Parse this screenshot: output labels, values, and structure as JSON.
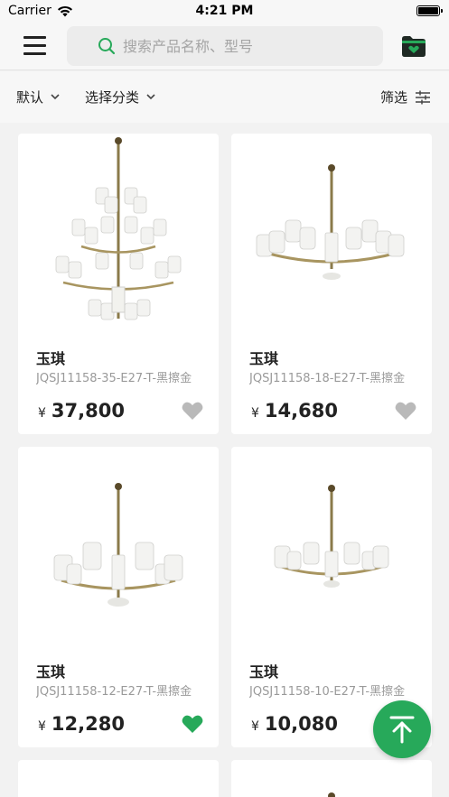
{
  "status_bar": {
    "carrier": "Carrier",
    "time": "4:21 PM"
  },
  "header": {
    "menu_icon": "hamburger-menu-icon",
    "search": {
      "placeholder": "搜索产品名称、型号",
      "value": ""
    },
    "favorites_icon": "favorites-folder-icon"
  },
  "filters": {
    "sort_label": "默认",
    "category_label": "选择分类",
    "screen_label": "筛选"
  },
  "products": [
    {
      "brand": "玉琪",
      "model": "JQSJ11158-35-E27-T-黑擦金",
      "currency": "¥",
      "price": "37,800",
      "favorited": false
    },
    {
      "brand": "玉琪",
      "model": "JQSJ11158-18-E27-T-黑擦金",
      "currency": "¥",
      "price": "14,680",
      "favorited": false
    },
    {
      "brand": "玉琪",
      "model": "JQSJ11158-12-E27-T-黑擦金",
      "currency": "¥",
      "price": "12,280",
      "favorited": true
    },
    {
      "brand": "玉琪",
      "model": "JQSJ11158-10-E27-T-黑擦金",
      "currency": "¥",
      "price": "10,080",
      "favorited": false
    }
  ],
  "colors": {
    "accent": "#27a95a",
    "heart_inactive": "#b9b9b9",
    "heart_active": "#27a95a"
  },
  "back_to_top_icon": "arrow-up-to-top-icon"
}
